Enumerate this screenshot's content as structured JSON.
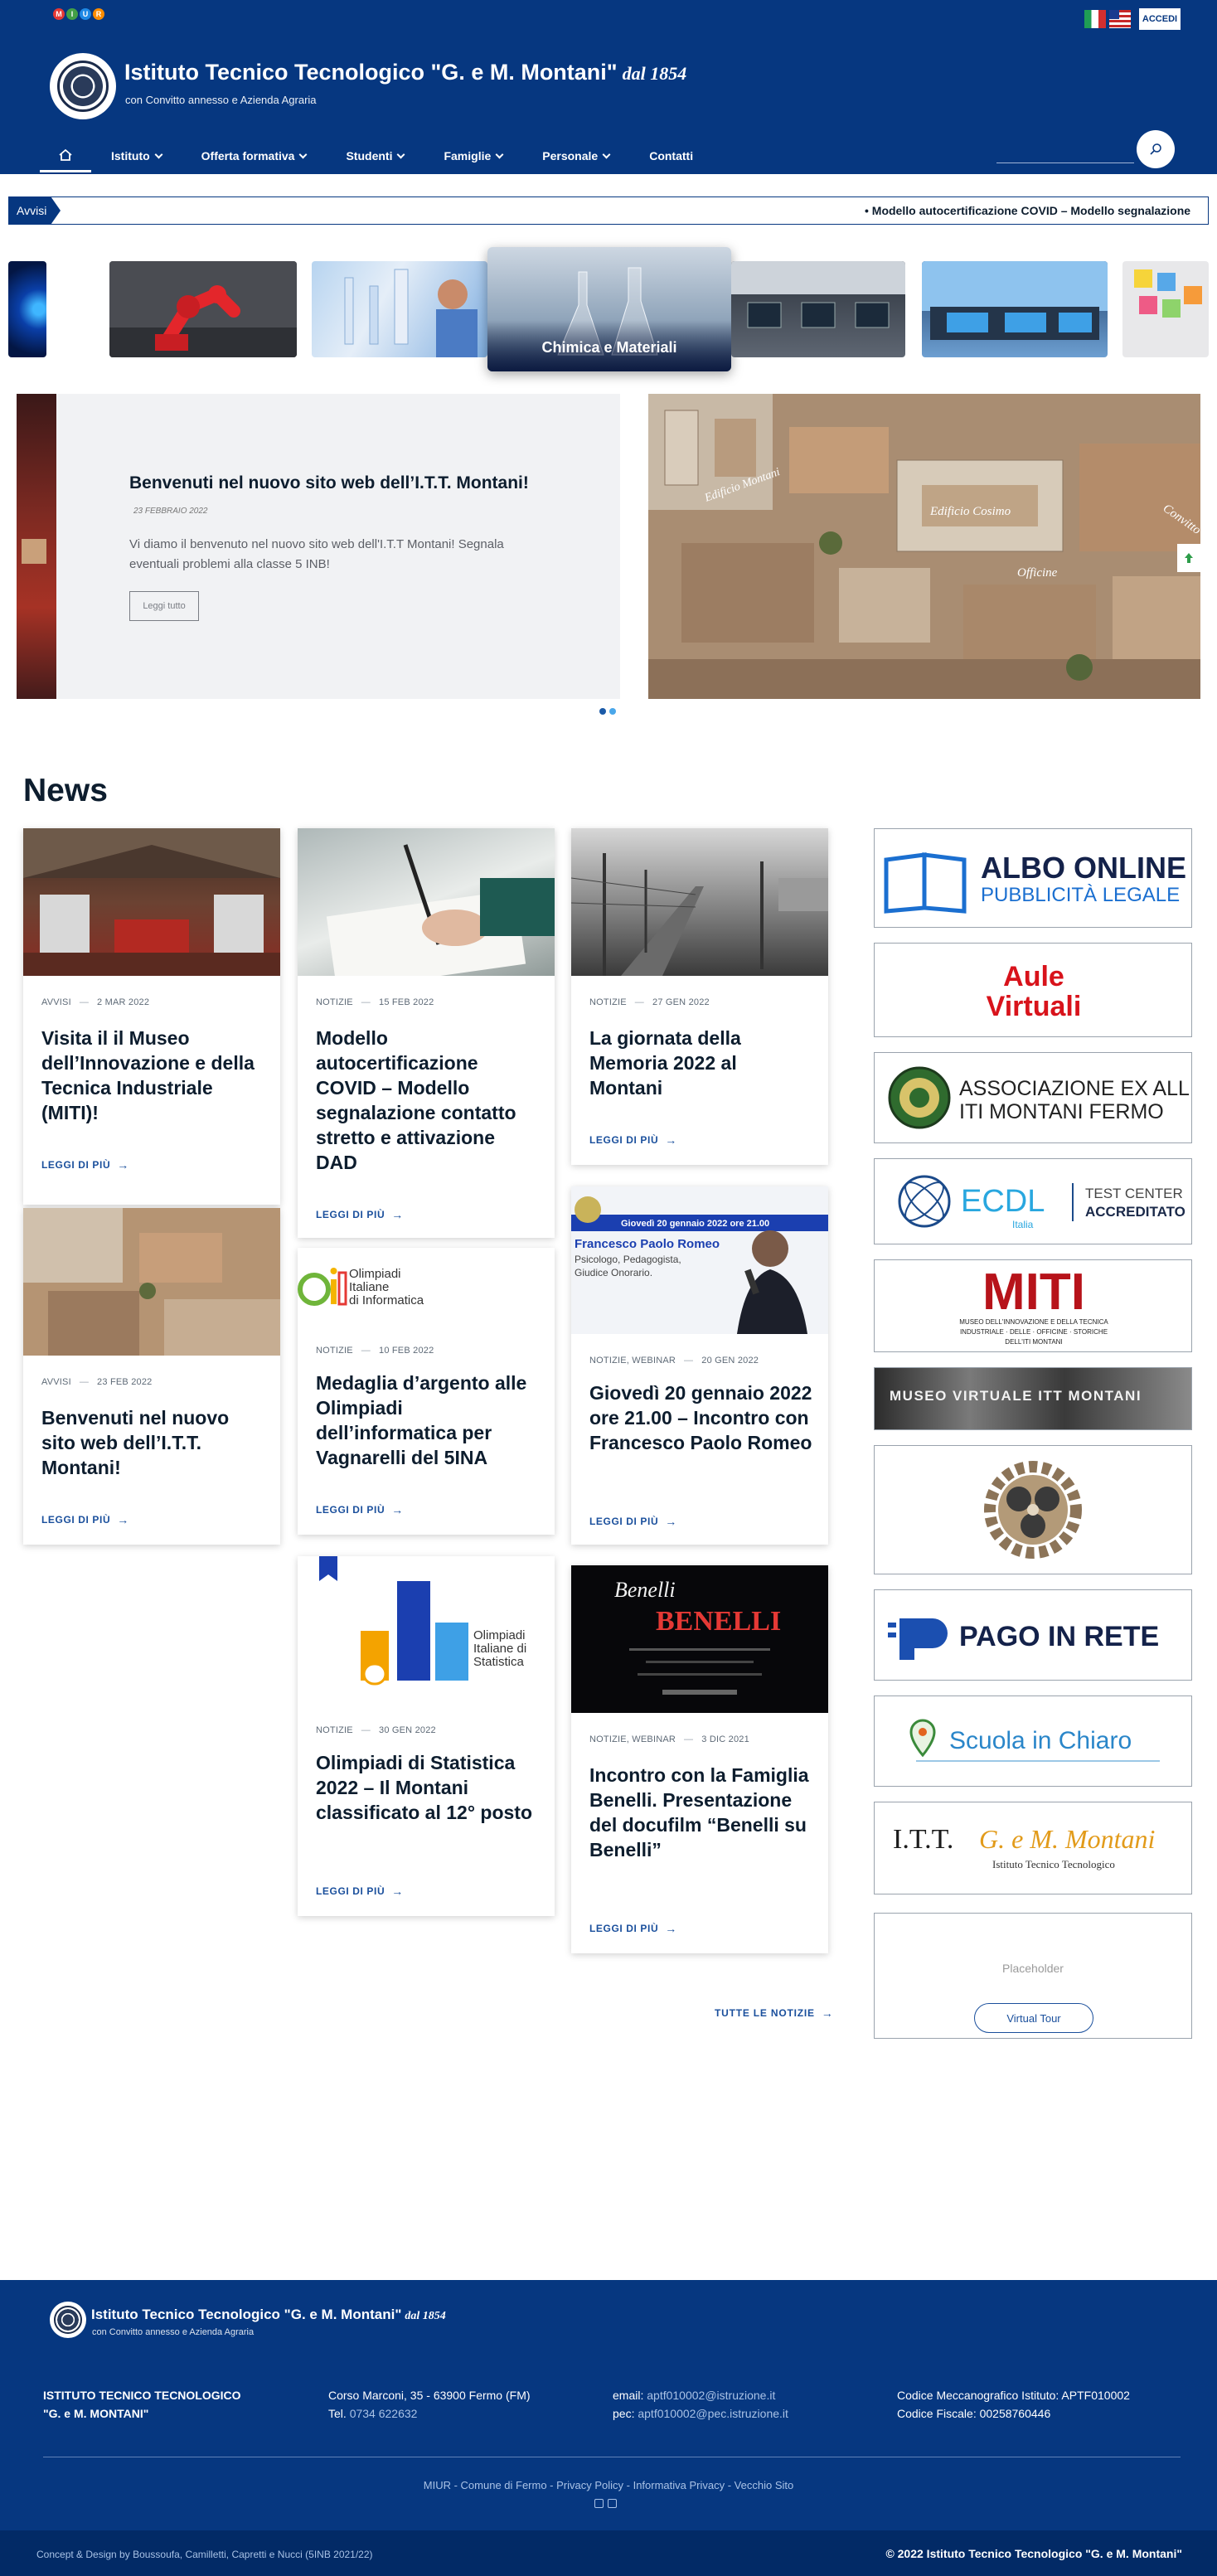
{
  "header": {
    "miur_letters": [
      "M",
      "I",
      "U",
      "R"
    ],
    "login_label": "ACCEDI",
    "title": "Istituto Tecnico Tecnologico \"G. e M. Montani\"",
    "title_year": "dal 1854",
    "subtitle": "con Convitto annesso e Azienda Agraria",
    "nav": [
      {
        "label": "Istituto"
      },
      {
        "label": "Offerta formativa"
      },
      {
        "label": "Studenti"
      },
      {
        "label": "Famiglie"
      },
      {
        "label": "Personale"
      },
      {
        "label": "Contatti"
      }
    ]
  },
  "ticker": {
    "label": "Avvisi",
    "text": "• Modello autocertificazione COVID – Modello segnalazione"
  },
  "categories": {
    "active_label": "Chimica e Materiali"
  },
  "hero": {
    "title": "Benvenuti nel nuovo sito web dell’I.T.T. Montani!",
    "date": "23 FEBBRAIO 2022",
    "text": "Vi diamo il benvenuto nel nuovo sito web dell'I.T.T Montani! Segnala eventuali problemi alla classe 5 INB!",
    "button": "Leggi tutto"
  },
  "aerial": {
    "labels": [
      "Edificio Cosimo",
      "Officine",
      "Convitto",
      "Edificio Montani"
    ]
  },
  "news": {
    "heading": "News",
    "read_more": "LEGGI DI PIÙ",
    "all_label": "TUTTE LE NOTIZIE",
    "cards": [
      {
        "category": "AVVISI",
        "date": "2 MAR 2022",
        "title": "Visita il il Museo dell’Innovazione e della Tecnica Industriale (MITI)!"
      },
      {
        "category": "NOTIZIE",
        "date": "15 FEB 2022",
        "title": "Modello autocertificazione COVID – Modello segnalazione contatto stretto e attivazione DAD"
      },
      {
        "category": "NOTIZIE",
        "date": "27 GEN 2022",
        "title": "La giornata della Memoria 2022 al Montani"
      },
      {
        "category": "AVVISI",
        "date": "23 FEB 2022",
        "title": "Benvenuti nel nuovo sito web dell’I.T.T. Montani!"
      },
      {
        "category": "NOTIZIE",
        "date": "10 FEB 2022",
        "title": "Medaglia d’argento alle Olimpiadi dell’informatica per Vagnarelli del 5INA",
        "logo_line1": "Olimpiadi",
        "logo_line2": "Italiane",
        "logo_line3": "di Informatica"
      },
      {
        "category": "NOTIZIE, WEBINAR",
        "date": "20 GEN 2022",
        "title": "Giovedì 20 gennaio 2022 ore 21.00 – Incontro con Francesco Paolo Romeo",
        "img_banner": "Giovedì 20 gennaio 2022 ore 21.00",
        "img_name": "Francesco Paolo Romeo",
        "img_desc1": "Psicologo, Pedagogista,",
        "img_desc2": "Giudice Onorario."
      },
      {
        "category": "NOTIZIE",
        "date": "30 GEN 2022",
        "title": "Olimpiadi di Statistica 2022 – Il Montani classificato al 12° posto",
        "logo_line1": "Olimpiadi",
        "logo_line2": "Italiane di",
        "logo_line3": "Statistica"
      },
      {
        "category": "NOTIZIE, WEBINAR",
        "date": "3 DIC 2021",
        "title": "Incontro con la Famiglia Benelli. Presentazione del docufilm “Benelli su Benelli”",
        "img_script": "Benelli",
        "img_word": "BENELLI"
      }
    ]
  },
  "sidebar": {
    "albo_1": "ALBO ONLINE",
    "albo_2": "PUBBLICITÀ LEGALE",
    "aule_1": "Aule",
    "aule_2": "Virtuali",
    "assoc_1": "ASSOCIAZIONE EX ALLIEVI",
    "assoc_2": "ITI MONTANI FERMO",
    "ecdl_1": "ECDL",
    "ecdl_2": "Italia",
    "ecdl_3": "TEST CENTER",
    "ecdl_4": "ACCREDITATO",
    "miti_1": "MITI",
    "miti_2": "MUSEO DELL'INNOVAZIONE E DELLA TECNICA",
    "miti_3": "INDUSTRIALE · DELLE · OFFICINE · STORICHE",
    "miti_4": "DELL'ITI MONTANI",
    "museo": "MUSEO VIRTUALE ITT MONTANI",
    "pago": "PAGO IN RETE",
    "scuola": "Scuola in Chiaro",
    "itt_1": "I.T.T.",
    "itt_2": "G. e M. Montani",
    "itt_3": "Istituto Tecnico Tecnologico",
    "placeholder": "Placeholder",
    "virtual_tour": "Virtual Tour"
  },
  "footer": {
    "title": "Istituto Tecnico Tecnologico \"G. e M. Montani\"",
    "title_year": "dal 1854",
    "subtitle": "con Convitto annesso e Azienda Agraria",
    "name_1": "ISTITUTO TECNICO TECNOLOGICO",
    "name_2": "\"G. e M. MONTANI\"",
    "address": "Corso Marconi, 35 - 63900 Fermo (FM)",
    "tel_label": "Tel.",
    "tel": "0734 622632",
    "email_label": "email:",
    "email": "aptf010002@istruzione.it",
    "pec_label": "pec:",
    "pec": "aptf010002@pec.istruzione.it",
    "codice_mecc": "Codice Meccanografico Istituto: APTF010002",
    "codice_fisc": "Codice Fiscale: 00258760446",
    "links": "MIUR - Comune di Fermo - Privacy Policy - Informativa Privacy - Vecchio Sito",
    "credit": "Concept & Design by Boussoufa, Camilletti, Capretti e Nucci (5INB 2021/22)",
    "copyright": "© 2022 Istituto Tecnico Tecnologico \"G. e M. Montani\""
  }
}
